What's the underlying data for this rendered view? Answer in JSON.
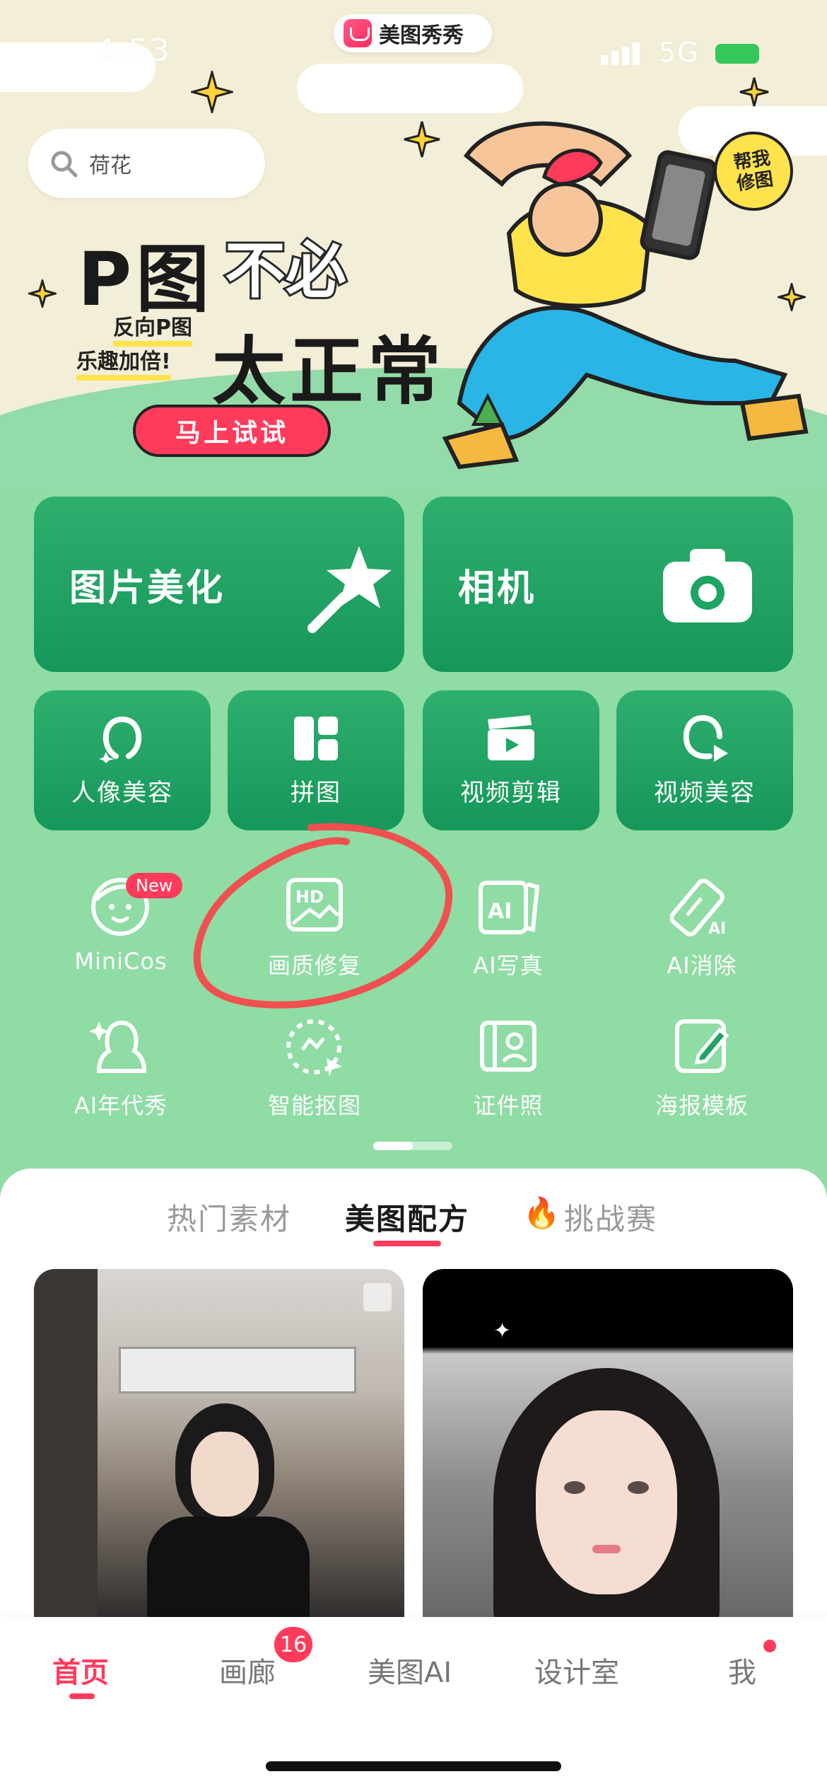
{
  "status_bar": {
    "time": "4:53",
    "network": "5G"
  },
  "app_pill": {
    "name": "美图秀秀"
  },
  "search": {
    "placeholder": "荷花"
  },
  "banner": {
    "title_left": "P图",
    "title_highlight": "不必",
    "title_bottom": "太正常",
    "tag1": "反向P图",
    "tag2": "乐趣加倍!",
    "sticker": "帮我修图",
    "cta": "马上试试"
  },
  "main_tiles": [
    {
      "label": "图片美化"
    },
    {
      "label": "相机"
    }
  ],
  "small_tiles": [
    {
      "label": "人像美容"
    },
    {
      "label": "拼图"
    },
    {
      "label": "视频剪辑"
    },
    {
      "label": "视频美容"
    }
  ],
  "tools": [
    {
      "label": "MiniCos",
      "badge": "New"
    },
    {
      "label": "画质修复"
    },
    {
      "label": "AI写真"
    },
    {
      "label": "AI消除"
    },
    {
      "label": "AI年代秀"
    },
    {
      "label": "智能抠图"
    },
    {
      "label": "证件照"
    },
    {
      "label": "海报模板"
    }
  ],
  "feed_tabs": [
    {
      "label": "热门素材"
    },
    {
      "label": "美图配方"
    },
    {
      "label": "挑战赛"
    }
  ],
  "nav": {
    "items": [
      {
        "label": "首页"
      },
      {
        "label": "画廊",
        "badge": "16"
      },
      {
        "label": "美图AI"
      },
      {
        "label": "设计室"
      },
      {
        "label": "我"
      }
    ]
  },
  "colors": {
    "accent": "#ff3b5c",
    "tile_green": "#1ea463",
    "bg_green": "#8fdca4"
  }
}
